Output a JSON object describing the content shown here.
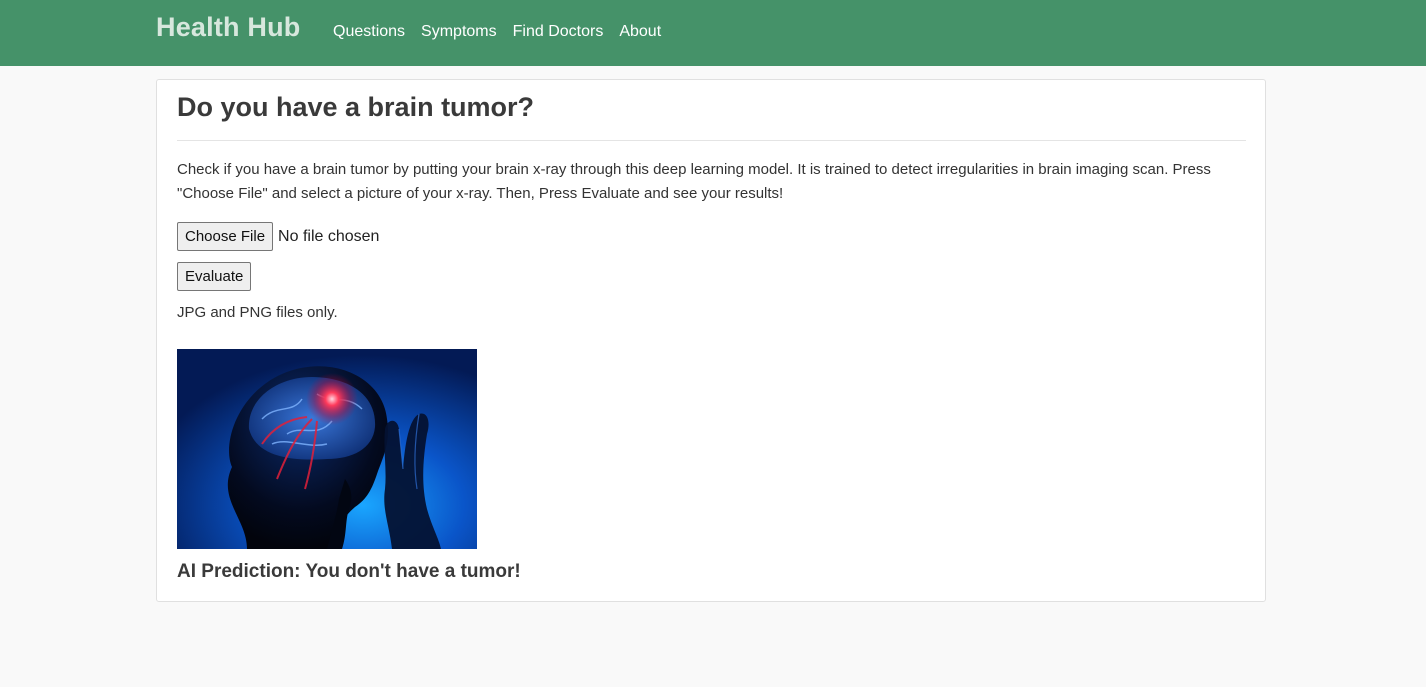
{
  "navbar": {
    "brand": "Health Hub",
    "links": [
      {
        "label": "Questions"
      },
      {
        "label": "Symptoms"
      },
      {
        "label": "Find Doctors"
      },
      {
        "label": "About"
      }
    ],
    "background_color": "#459269"
  },
  "main": {
    "title": "Do you have a brain tumor?",
    "description": "Check if you have a brain tumor by putting your brain x-ray through this deep learning model. It is trained to detect irregularities in brain imaging scan. Press \"Choose File\" and select a picture of your x-ray. Then, Press Evaluate and see your results!",
    "file_input": {
      "button_label": "Choose File",
      "status": "No file chosen"
    },
    "evaluate_label": "Evaluate",
    "file_note": "JPG and PNG files only.",
    "image_icon": "brain-headache-illustration",
    "prediction": "AI Prediction: You don't have a tumor!"
  }
}
